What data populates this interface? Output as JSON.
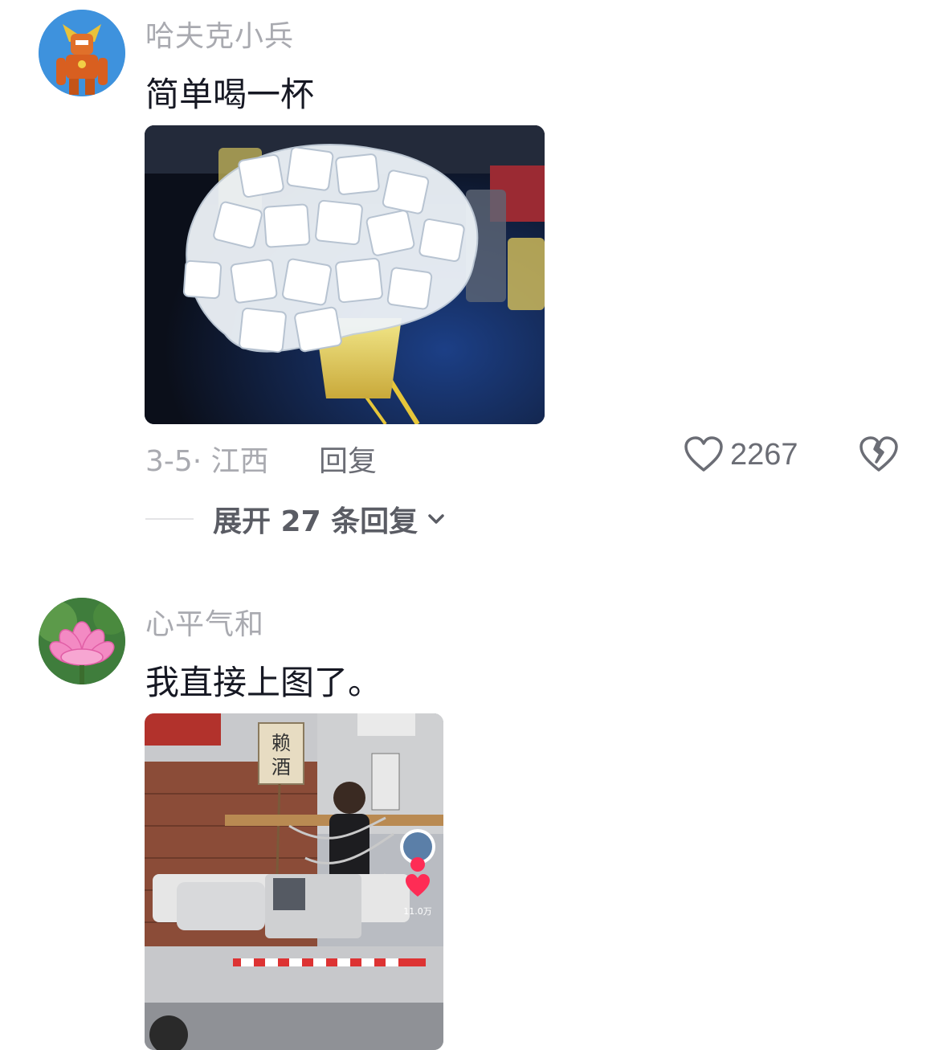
{
  "comments": [
    {
      "username": "哈夫克小兵",
      "avatar_icon": "robot-character-avatar",
      "text": "简单喝一杯",
      "image_icon": "ice-cubes-on-beer-glass-photo",
      "date_location": "3-5· 江西",
      "reply_label": "回复",
      "like_count": "2267",
      "expand_label": "展开 27 条回复"
    },
    {
      "username": "心平气和",
      "avatar_icon": "lotus-flower-avatar",
      "text": "我直接上图了。",
      "image_icon": "man-tied-on-truck-video-screenshot",
      "sign_text": "赖酒",
      "video_like_count": "11.0万"
    }
  ],
  "colors": {
    "username": "#a9aab0",
    "body_text": "#161823",
    "meta_text": "#6b6d75",
    "like_icon": "#6b6d75"
  }
}
